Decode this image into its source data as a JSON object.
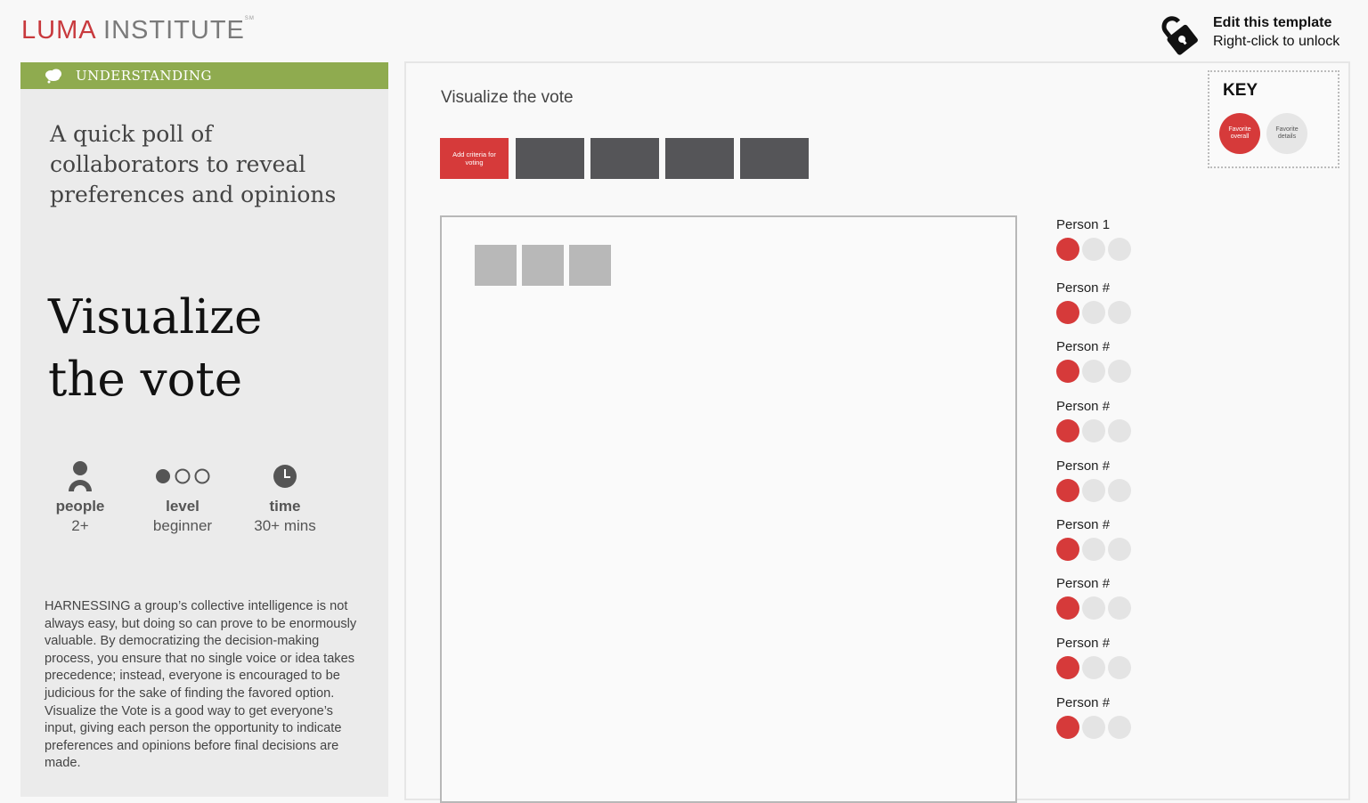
{
  "header": {
    "logo_primary": "LUMA",
    "logo_secondary": "INSTITUTE",
    "logo_mark": "SM",
    "unlock_title": "Edit this template",
    "unlock_subtitle": "Right-click to unlock"
  },
  "sidebar": {
    "category": "UNDERSTANDING",
    "intro": "A quick poll of collaborators to reveal preferences and opinions",
    "method_line1": "Visualize",
    "method_line2": "the vote",
    "meta": [
      {
        "label": "people",
        "value": "2+"
      },
      {
        "label": "level",
        "value": "beginner"
      },
      {
        "label": "time",
        "value": "30+ mins"
      }
    ],
    "description": "HARNESSING a group’s collective intelligence is not always easy, but doing so can prove to be enormously valuable. By democratizing the decision-making process, you ensure that no single voice or idea takes precedence; instead, everyone is encouraged to be judicious for the sake of finding the favored option. Visualize the Vote is a good way to get everyone’s input, giving each person the opportunity to indicate preferences and opinions before final decisions are made."
  },
  "canvas": {
    "title": "Visualize the vote",
    "criteria_first": "Add criteria for voting",
    "key": {
      "title": "KEY",
      "items": [
        "Favorite overall",
        "Favorite details"
      ]
    },
    "persons": [
      {
        "name": "Person 1"
      },
      {
        "name": "Person #"
      },
      {
        "name": "Person #"
      },
      {
        "name": "Person #"
      },
      {
        "name": "Person #"
      },
      {
        "name": "Person #"
      },
      {
        "name": "Person #"
      },
      {
        "name": "Person #"
      },
      {
        "name": "Person #"
      }
    ]
  },
  "colors": {
    "brand_red": "#c8393d",
    "vote_red": "#d63a3a",
    "category_green": "#8fab4f",
    "criteria_dark": "#555558"
  }
}
